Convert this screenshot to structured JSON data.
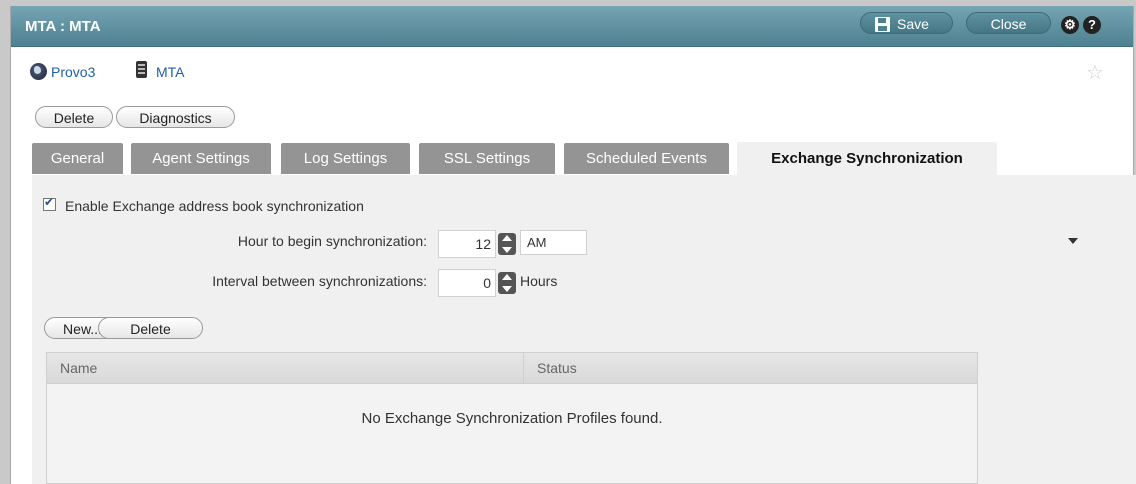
{
  "window": {
    "title": "MTA : MTA",
    "save_label": "Save",
    "close_label": "Close",
    "gear_glyph": "⚙",
    "help_glyph": "?"
  },
  "breadcrumb": {
    "items": [
      {
        "label": "Provo3",
        "icon": "globe-icon"
      },
      {
        "label": "MTA",
        "icon": "server-icon"
      }
    ],
    "favorite_icon": "star-icon"
  },
  "actions": {
    "delete_label": "Delete",
    "diagnostics_label": "Diagnostics"
  },
  "tabs": [
    {
      "label": "General",
      "active": false
    },
    {
      "label": "Agent Settings",
      "active": false
    },
    {
      "label": "Log Settings",
      "active": false
    },
    {
      "label": "SSL Settings",
      "active": false
    },
    {
      "label": "Scheduled Events",
      "active": false
    },
    {
      "label": "Exchange Synchronization",
      "active": true
    }
  ],
  "exchange_sync": {
    "enable_label": "Enable Exchange address book synchronization",
    "enabled": true,
    "hour_label": "Hour to begin synchronization:",
    "hour_value": "12",
    "ampm_value": "AM",
    "interval_label": "Interval between synchronizations:",
    "interval_value": "0",
    "interval_unit": "Hours"
  },
  "profiles": {
    "new_label": "New...",
    "delete_label": "Delete",
    "columns": [
      "Name",
      "Status"
    ],
    "empty_message": "No Exchange Synchronization Profiles found."
  },
  "colors": {
    "titlebar": "#5a8c9b",
    "inactive_tab": "#949494",
    "panel": "#f0f0f0",
    "link": "#1f5fa8"
  }
}
